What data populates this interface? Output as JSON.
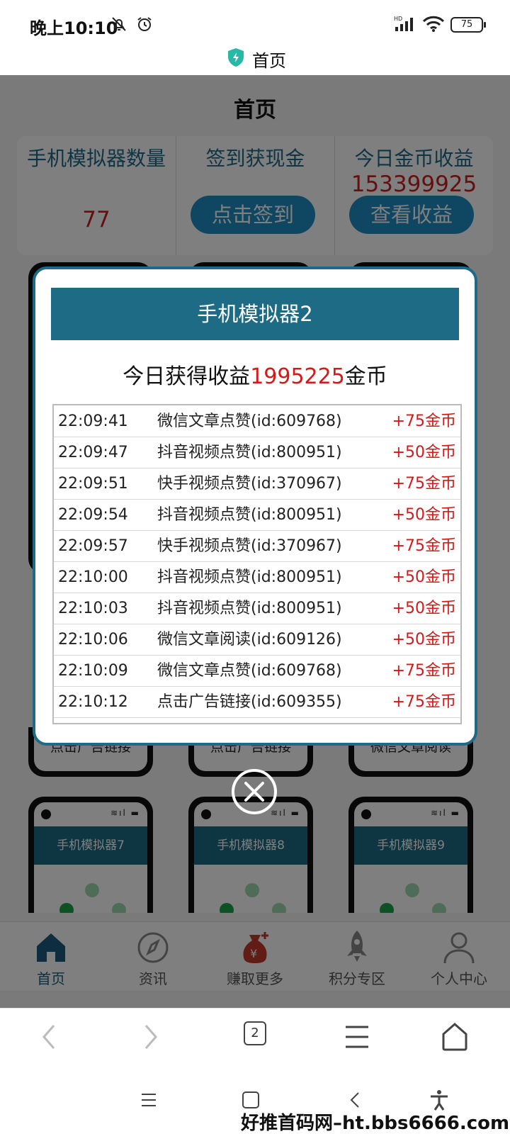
{
  "status_bar": {
    "time": "晚上10:10",
    "battery": "75",
    "signal_label": "HD"
  },
  "browser_title": "首页",
  "page": {
    "heading": "首页",
    "stats": {
      "emulator_count_label": "手机模拟器数量",
      "emulator_count_value": "77",
      "checkin_label": "签到获现金",
      "checkin_button": "点击签到",
      "today_coins_label": "今日金币收益",
      "today_coins_value": "153399925",
      "view_earnings_button": "查看收益"
    },
    "phones_row_top": [
      "点击广告链接",
      "点击广告链接",
      "微信文章阅读"
    ],
    "phones_row_bottom": [
      "手机模拟器7",
      "手机模拟器8",
      "手机模拟器9"
    ],
    "tabs": [
      {
        "label": "首页",
        "icon": "home-icon",
        "active": true
      },
      {
        "label": "资讯",
        "icon": "compass-icon",
        "active": false
      },
      {
        "label": "赚取更多",
        "icon": "money-bag-icon",
        "active": false
      },
      {
        "label": "积分专区",
        "icon": "rocket-icon",
        "active": false
      },
      {
        "label": "个人中心",
        "icon": "user-icon",
        "active": false
      }
    ]
  },
  "modal": {
    "title": "手机模拟器2",
    "summary_prefix": "今日获得收益",
    "summary_amount": "1995225",
    "summary_suffix": "金币",
    "log": [
      {
        "time": "22:09:41",
        "action": "微信文章点赞(id:609768)",
        "reward": "+75金币"
      },
      {
        "time": "22:09:47",
        "action": "抖音视频点赞(id:800951)",
        "reward": "+50金币"
      },
      {
        "time": "22:09:51",
        "action": "快手视频点赞(id:370967)",
        "reward": "+75金币"
      },
      {
        "time": "22:09:54",
        "action": "抖音视频点赞(id:800951)",
        "reward": "+50金币"
      },
      {
        "time": "22:09:57",
        "action": "快手视频点赞(id:370967)",
        "reward": "+75金币"
      },
      {
        "time": "22:10:00",
        "action": "抖音视频点赞(id:800951)",
        "reward": "+50金币"
      },
      {
        "time": "22:10:03",
        "action": "抖音视频点赞(id:800951)",
        "reward": "+50金币"
      },
      {
        "time": "22:10:06",
        "action": "微信文章阅读(id:609126)",
        "reward": "+50金币"
      },
      {
        "time": "22:10:09",
        "action": "微信文章点赞(id:609768)",
        "reward": "+75金币"
      },
      {
        "time": "22:10:12",
        "action": "点击广告链接(id:609355)",
        "reward": "+75金币"
      }
    ]
  },
  "browser_toolbar": {
    "tab_count": "2"
  },
  "watermark": "好推首码网–ht.bbs6666.com",
  "colors": {
    "primary": "#1d6b84",
    "button_blue": "#1f8fc6",
    "accent_red": "#d21a1a",
    "dot_green": "#1aa34a"
  }
}
